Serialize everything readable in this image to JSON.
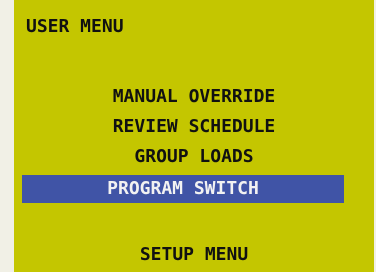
{
  "screen": {
    "title": "USER MENU",
    "bg_color": "#c4c600",
    "highlight_color": "#4054a6",
    "menu_items": [
      {
        "label": "MANUAL OVERRIDE",
        "selected": false
      },
      {
        "label": "REVIEW SCHEDULE",
        "selected": false
      },
      {
        "label": "GROUP LOADS",
        "selected": false
      },
      {
        "label": "PROGRAM SWITCH",
        "selected": true
      },
      {
        "label": "SETUP MENU",
        "selected": false
      }
    ]
  }
}
